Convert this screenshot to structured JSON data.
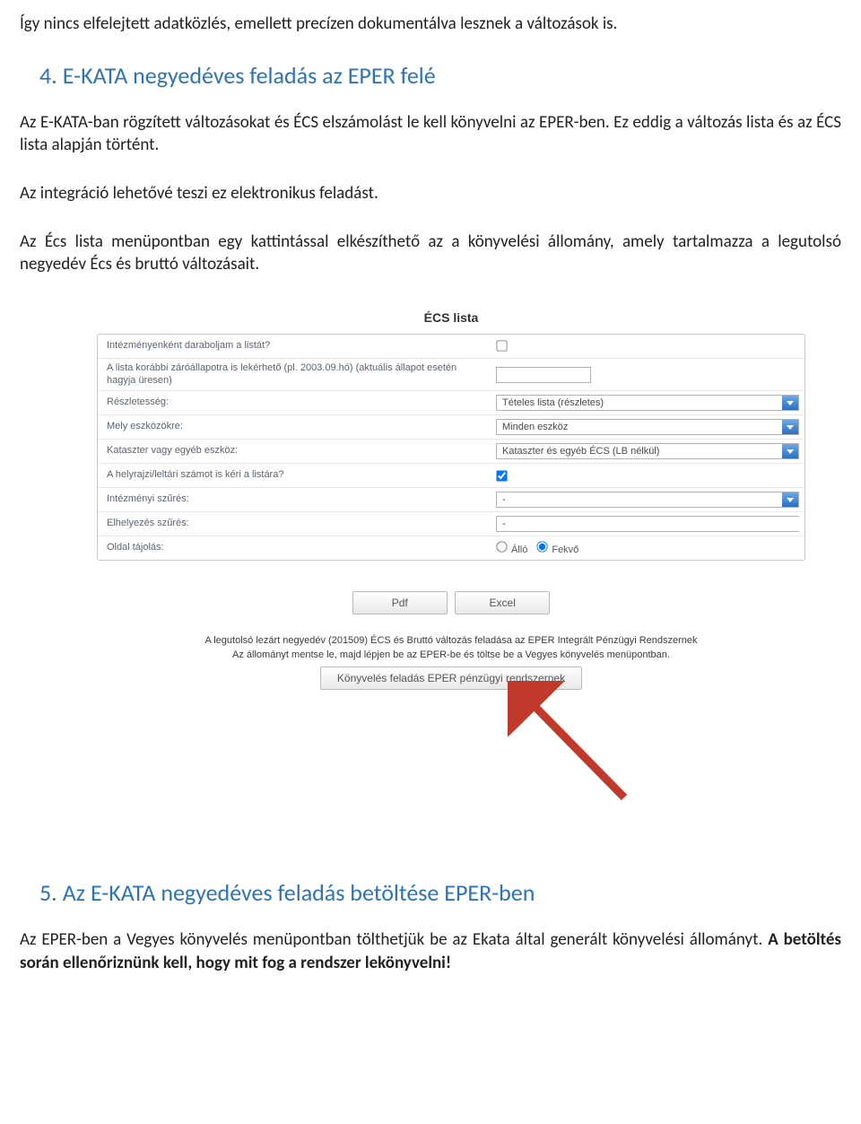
{
  "intro_text": "Így nincs elfelejtett adatközlés, emellett precízen dokumentálva lesznek a változások is.",
  "section4": {
    "num": "4.",
    "title": "E-KATA negyedéves feladás az EPER felé",
    "p1": "Az E-KATA-ban rögzített változásokat és ÉCS elszámolást le kell könyvelni az EPER-ben. Ez eddig a változás lista és az ÉCS lista alapján történt.",
    "p2": "Az integráció lehetővé teszi ez elektronikus feladást.",
    "p3": "Az Écs lista menüpontban egy kattintással elkészíthető az a könyvelési állomány, amely tartalmazza a legutolsó negyedév Écs és bruttó változásait."
  },
  "screenshot": {
    "title": "ÉCS lista",
    "rows": {
      "r1": "Intézményenként daraboljam a listát?",
      "r2": "A lista korábbi záróállapotra is lekérhető (pl. 2003.09.hó) (aktuális állapot esetén hagyja üresen)",
      "r3": "Részletesség:",
      "r4": "Mely eszközökre:",
      "r5": "Kataszter vagy egyéb eszköz:",
      "r6": "A helyrajzi/leltári számot is kéri a listára?",
      "r7": "Intézményi szűrés:",
      "r8": "Elhelyezés szűrés:",
      "r9": "Oldal tájolás:"
    },
    "values": {
      "v3": "Tételes lista (részletes)",
      "v4": "Minden eszköz",
      "v5": "Kataszter és egyéb ÉCS (LB nélkül)",
      "v7": "-",
      "v8": "-",
      "radio_allo": "Álló",
      "radio_fekvo": "Fekvő"
    },
    "buttons": {
      "pdf": "Pdf",
      "excel": "Excel",
      "eper": "Könyvelés feladás EPER pénzügyi rendszernek"
    },
    "note_line1": "A legutolsó lezárt negyedév (201509) ÉCS és Bruttó változás feladása az EPER Integrált Pénzügyi Rendszernek",
    "note_line2": "Az állományt mentse le, majd lépjen be az EPER-be és töltse be a Vegyes könyvelés menüpontban."
  },
  "section5": {
    "num": "5.",
    "title": "Az E-KATA negyedéves feladás betöltése EPER-ben",
    "p1_prefix": "Az EPER-ben a Vegyes könyvelés menüpontban tölthetjük be az Ekata által generált könyvelési állományt. ",
    "p1_bold": "A betöltés során ellenőriznünk kell, hogy mit fog a rendszer lekönyvelni!"
  }
}
